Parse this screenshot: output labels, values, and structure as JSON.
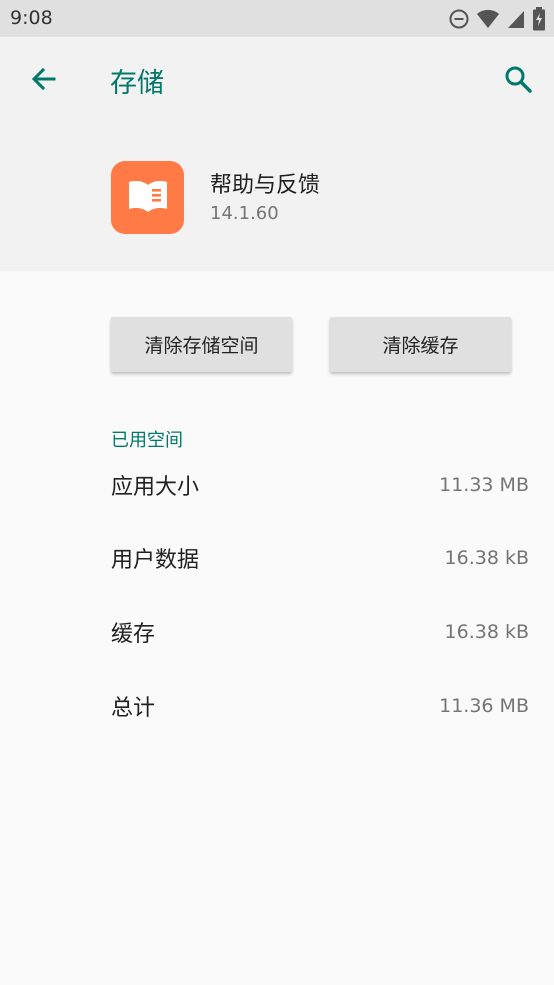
{
  "status_bar": {
    "time": "9:08",
    "icons": [
      "do-not-disturb-icon",
      "wifi-icon",
      "signal-icon",
      "battery-charging-icon"
    ]
  },
  "header": {
    "title": "存储",
    "back_icon": "back-arrow-icon",
    "search_icon": "search-icon",
    "accent_color": "#00796b"
  },
  "app": {
    "name": "帮助与反馈",
    "version": "14.1.60",
    "icon_color": "#ff7a45"
  },
  "actions": {
    "clear_storage_label": "清除存储空间",
    "clear_cache_label": "清除缓存"
  },
  "storage": {
    "section_title": "已用空间",
    "rows": [
      {
        "label": "应用大小",
        "value": "11.33 MB"
      },
      {
        "label": "用户数据",
        "value": "16.38 kB"
      },
      {
        "label": "缓存",
        "value": "16.38 kB"
      },
      {
        "label": "总计",
        "value": "11.36 MB"
      }
    ]
  }
}
